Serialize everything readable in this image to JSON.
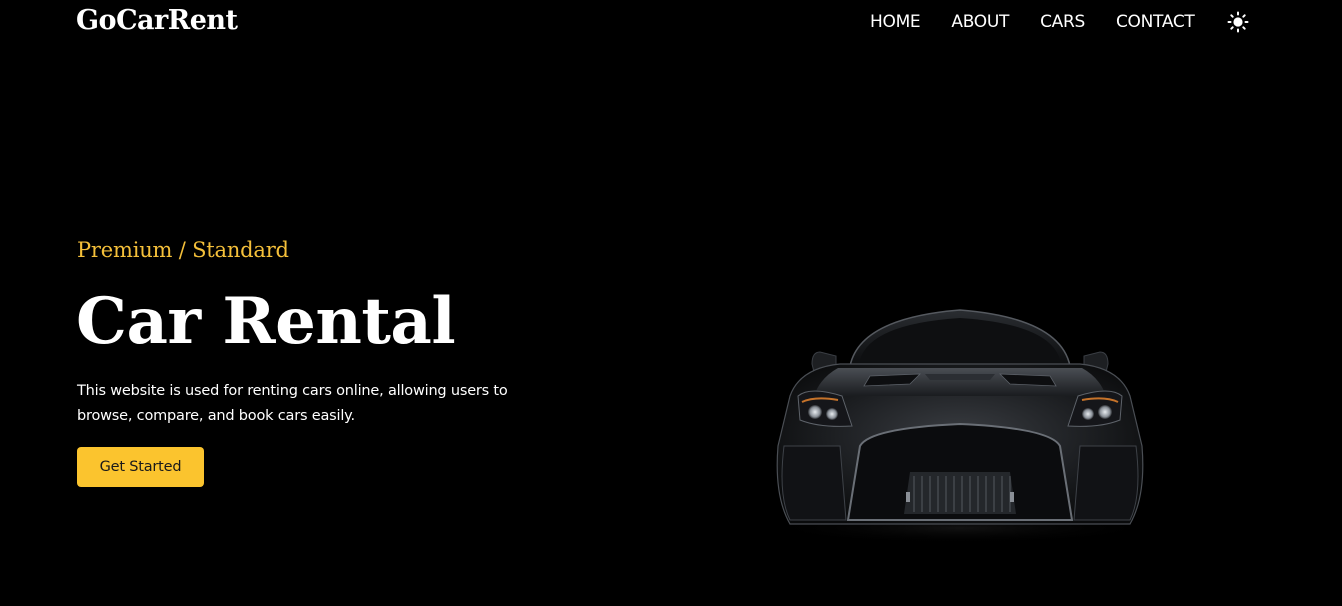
{
  "header": {
    "logo": "GoCarRent",
    "nav": [
      {
        "label": "HOME"
      },
      {
        "label": "ABOUT"
      },
      {
        "label": "CARS"
      },
      {
        "label": "CONTACT"
      }
    ],
    "theme_toggle_icon": "sun-icon"
  },
  "hero": {
    "subtitle": "Premium / Standard",
    "title": "Car Rental",
    "description": "This website is used for renting cars online, allowing users to browse, compare, and book cars easily.",
    "cta_label": "Get Started",
    "image_icon": "sports-car-image"
  },
  "colors": {
    "background": "#000000",
    "accent": "#fbc42e",
    "subtitle": "#f5c03a",
    "text": "#ffffff",
    "button_text": "#1a1a1a"
  }
}
